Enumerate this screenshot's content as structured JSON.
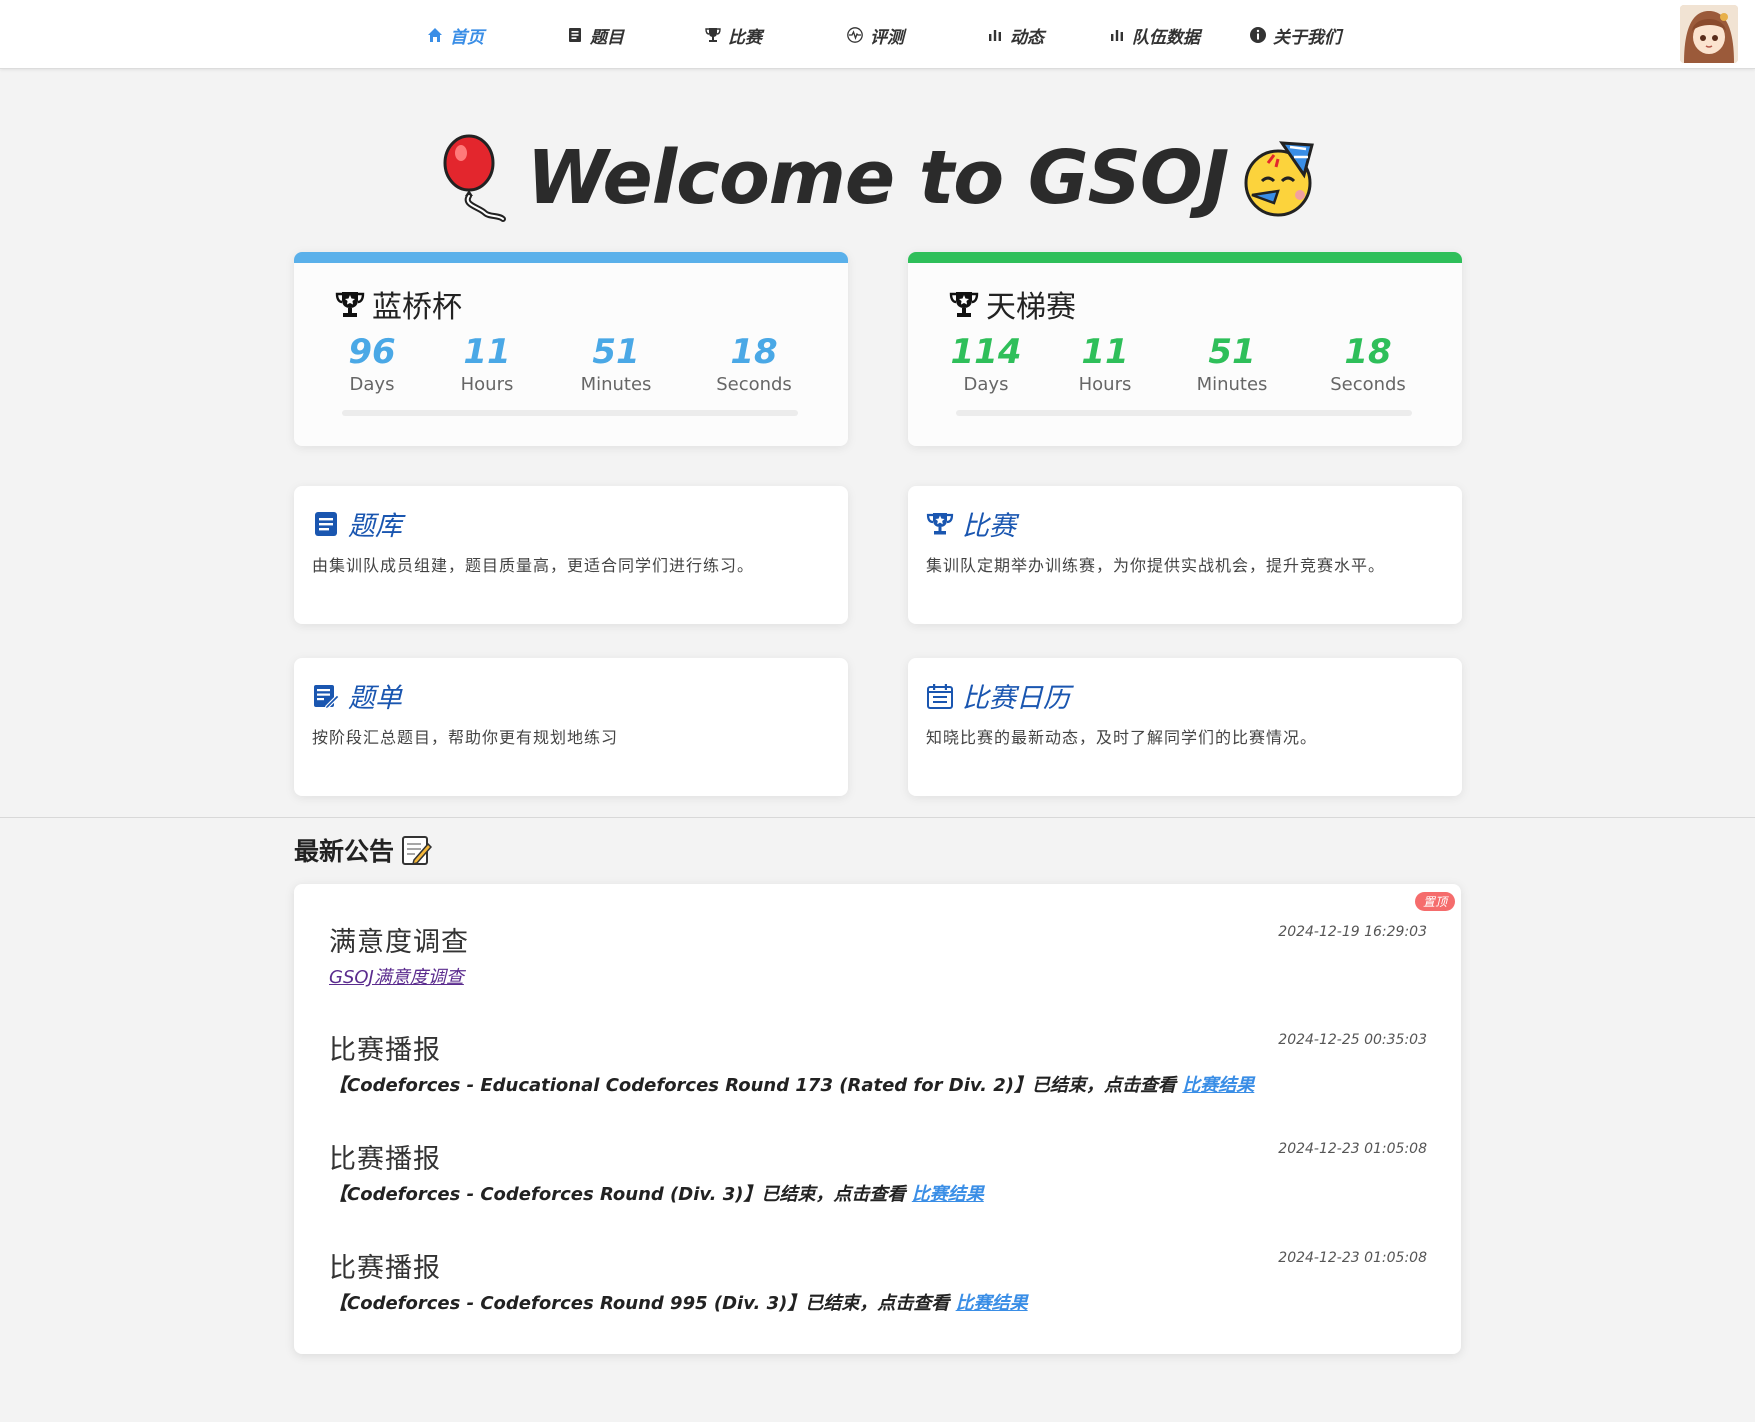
{
  "nav": {
    "items": [
      {
        "label": "首页",
        "icon": "home-icon",
        "active": true
      },
      {
        "label": "题目",
        "icon": "document-icon",
        "active": false
      },
      {
        "label": "比赛",
        "icon": "trophy-icon",
        "active": false
      },
      {
        "label": "评测",
        "icon": "pulse-icon",
        "active": false
      },
      {
        "label": "动态",
        "icon": "bar-chart-icon",
        "active": false
      },
      {
        "label": "队伍数据",
        "icon": "bar-chart-icon",
        "active": false
      },
      {
        "label": "关于我们",
        "icon": "info-icon",
        "active": false
      }
    ],
    "accent": "#3a8ee6"
  },
  "welcome": {
    "title": "Welcome to GSOJ"
  },
  "countdowns": [
    {
      "title": "蓝桥杯",
      "color": "#4aa8e6",
      "units": [
        {
          "value": "96",
          "label": "Days"
        },
        {
          "value": "11",
          "label": "Hours"
        },
        {
          "value": "51",
          "label": "Minutes"
        },
        {
          "value": "18",
          "label": "Seconds"
        }
      ]
    },
    {
      "title": "天梯赛",
      "color": "#2fbf5a",
      "units": [
        {
          "value": "114",
          "label": "Days"
        },
        {
          "value": "11",
          "label": "Hours"
        },
        {
          "value": "51",
          "label": "Minutes"
        },
        {
          "value": "18",
          "label": "Seconds"
        }
      ]
    }
  ],
  "features": [
    {
      "title": "题库",
      "desc": "由集训队成员组建，题目质量高，更适合同学们进行练习。",
      "icon": "document-icon"
    },
    {
      "title": "比赛",
      "desc": "集训队定期举办训练赛，为你提供实战机会，提升竞赛水平。",
      "icon": "trophy-star-icon"
    },
    {
      "title": "题单",
      "desc": "按阶段汇总题目，帮助你更有规划地练习",
      "icon": "edit-list-icon"
    },
    {
      "title": "比赛日历",
      "desc": "知晓比赛的最新动态，及时了解同学们的比赛情况。",
      "icon": "calendar-icon"
    }
  ],
  "announcements": {
    "heading": "最新公告",
    "pin_badge": "置顶",
    "items": [
      {
        "title": "满意度调查",
        "time": "2024-12-19 16:29:03",
        "body_text": "",
        "link_text": "GSOJ满意度调查"
      },
      {
        "title": "比赛播报",
        "time": "2024-12-25 00:35:03",
        "body_text": "【Codeforces - Educational Codeforces Round 173 (Rated for Div. 2)】已结束，点击查看 ",
        "link_text": "比赛结果"
      },
      {
        "title": "比赛播报",
        "time": "2024-12-23 01:05:08",
        "body_text": "【Codeforces - Codeforces Round (Div. 3)】已结束，点击查看 ",
        "link_text": "比赛结果"
      },
      {
        "title": "比赛播报",
        "time": "2024-12-23 01:05:08",
        "body_text": "【Codeforces - Codeforces Round 995 (Div. 3)】已结束，点击查看 ",
        "link_text": "比赛结果"
      }
    ]
  }
}
